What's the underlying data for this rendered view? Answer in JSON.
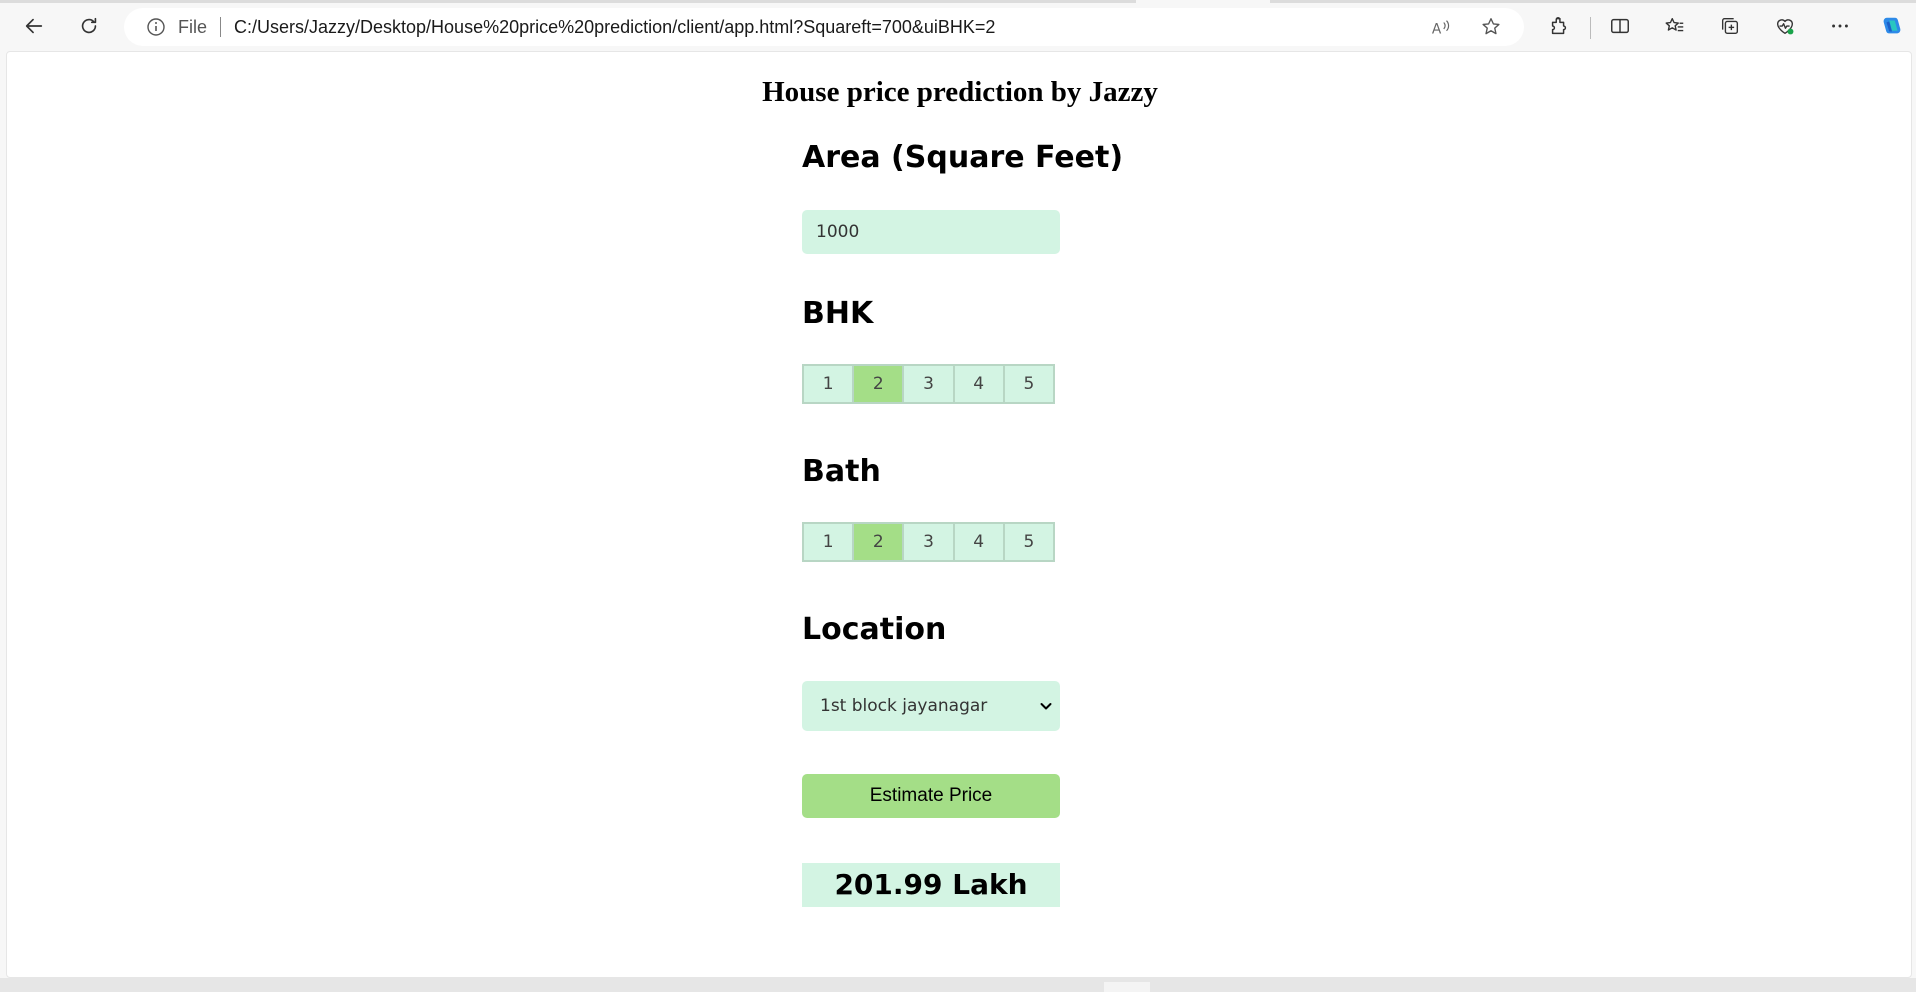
{
  "browser": {
    "file_label": "File",
    "url": "C:/Users/Jazzy/Desktop/House%20price%20prediction/client/app.html?Squareft=700&uiBHK=2",
    "icons": [
      "back-icon",
      "refresh-icon",
      "info-icon",
      "read-aloud-icon",
      "favorite-star-icon",
      "extensions-icon",
      "split-screen-icon",
      "favorites-icon",
      "collections-icon",
      "browser-essentials-icon",
      "more-icon",
      "copilot-icon"
    ]
  },
  "page": {
    "title": "House price prediction by Jazzy",
    "area": {
      "label": "Area (Square Feet)",
      "value": "1000"
    },
    "bhk": {
      "label": "BHK",
      "options": [
        "1",
        "2",
        "3",
        "4",
        "5"
      ],
      "selected": "2"
    },
    "bath": {
      "label": "Bath",
      "options": [
        "1",
        "2",
        "3",
        "4",
        "5"
      ],
      "selected": "2"
    },
    "location": {
      "label": "Location",
      "selected": "1st block jayanagar"
    },
    "estimate_button": "Estimate Price",
    "result": "201.99 Lakh"
  },
  "colors": {
    "input_bg": "#d3f4e3",
    "accent_green": "#a4de87"
  }
}
